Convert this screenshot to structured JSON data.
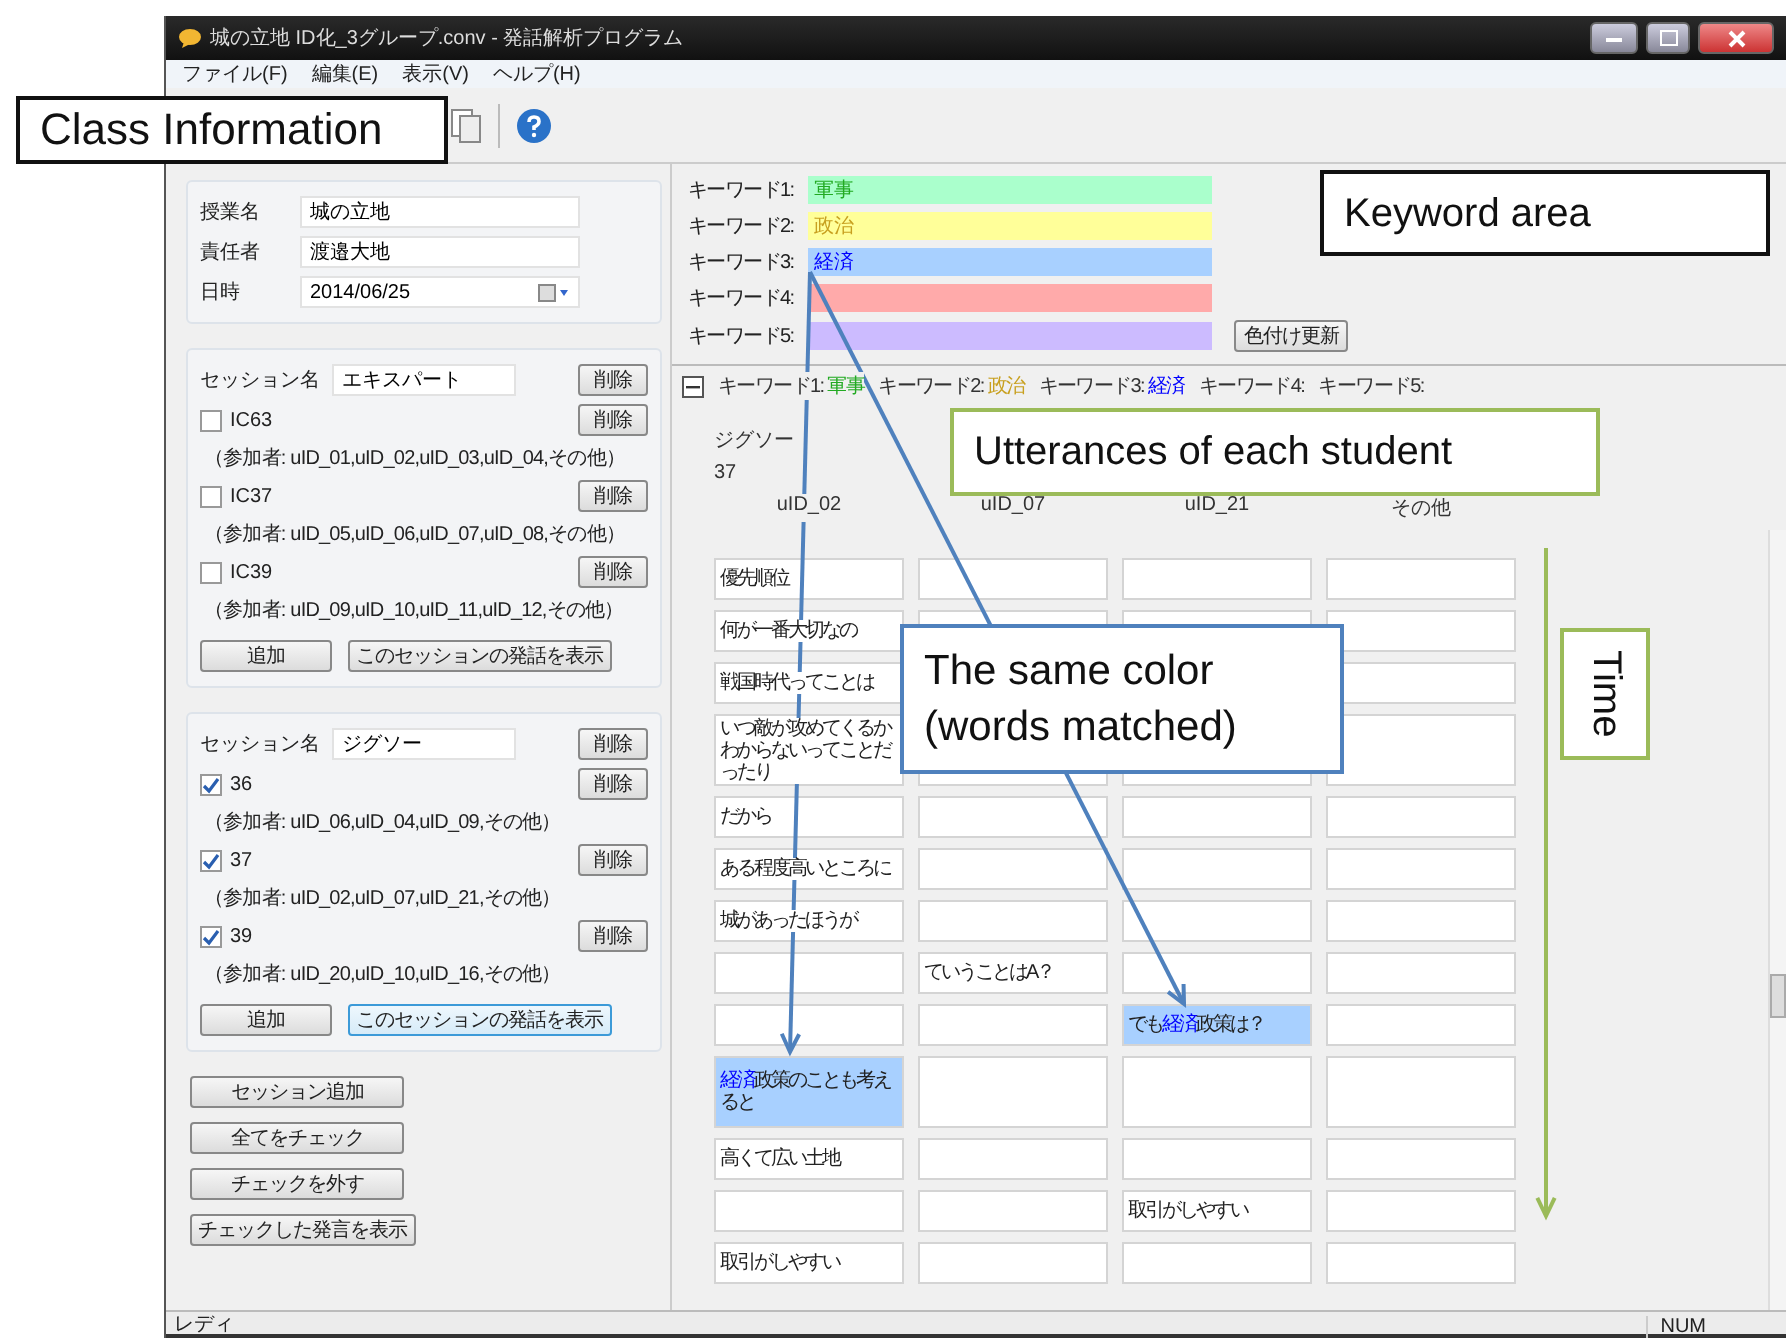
{
  "window": {
    "title": "城の立地 ID化_3グループ.conv - 発話解析プログラム"
  },
  "menu": [
    "ファイル(F)",
    "編集(E)",
    "表示(V)",
    "ヘルプ(H)"
  ],
  "class_info": {
    "fields": [
      {
        "label": "授業名",
        "value": "城の立地",
        "kind": "text"
      },
      {
        "label": "責任者",
        "value": "渡邉大地",
        "kind": "text"
      },
      {
        "label": "日時",
        "value": "2014/06/25",
        "kind": "date"
      }
    ]
  },
  "sessions": [
    {
      "name_label": "セッション名",
      "name": "エキスパート",
      "delete_label": "削除",
      "add_label": "追加",
      "show_label": "このセッションの発話を表示",
      "show_focused": false,
      "groups": [
        {
          "label": "IC63",
          "checked": false,
          "delete_label": "削除",
          "members": "（参加者: uID_01,uID_02,uID_03,uID_04,その他）"
        },
        {
          "label": "IC37",
          "checked": false,
          "delete_label": "削除",
          "members": "（参加者: uID_05,uID_06,uID_07,uID_08,その他）"
        },
        {
          "label": "IC39",
          "checked": false,
          "delete_label": "削除",
          "members": "（参加者: uID_09,uID_10,uID_11,uID_12,その他）"
        }
      ]
    },
    {
      "name_label": "セッション名",
      "name": "ジグソー",
      "delete_label": "削除",
      "add_label": "追加",
      "show_label": "このセッションの発話を表示",
      "show_focused": true,
      "groups": [
        {
          "label": "36",
          "checked": true,
          "delete_label": "削除",
          "members": "（参加者: uID_06,uID_04,uID_09,その他）"
        },
        {
          "label": "37",
          "checked": true,
          "delete_label": "削除",
          "members": "（参加者: uID_02,uID_07,uID_21,その他）"
        },
        {
          "label": "39",
          "checked": true,
          "delete_label": "削除",
          "members": "（参加者: uID_20,uID_10,uID_16,その他）"
        }
      ]
    }
  ],
  "actions": [
    "セッション追加",
    "全てをチェック",
    "チェックを外す",
    "チェックした発言を表示"
  ],
  "keywords": {
    "update_label": "色付け更新",
    "items": [
      {
        "label": "キーワード1:",
        "value": {
          "text": "軍事",
          "color": "#22aa22"
        },
        "field": {
          "color": "#aaffcc"
        }
      },
      {
        "label": "キーワード2:",
        "value": {
          "text": "政治",
          "color": "#c8a020"
        },
        "field": {
          "color": "#ffff99"
        }
      },
      {
        "label": "キーワード3:",
        "value": {
          "text": "経済",
          "color": "#0000ff"
        },
        "field": {
          "color": "#a8d0ff"
        }
      },
      {
        "label": "キーワード4:",
        "field": {
          "color": "#ffaaaa"
        }
      },
      {
        "label": "キーワード5:",
        "field": {
          "color": "#ccbbff"
        }
      }
    ]
  },
  "keyword_bar": {
    "expanded": true,
    "items": [
      {
        "label": "キーワード1:",
        "value": {
          "text": "軍事",
          "color": "#22aa22"
        }
      },
      {
        "label": "キーワード2:",
        "value": {
          "text": "政治",
          "color": "#c8a020"
        }
      },
      {
        "label": "キーワード3:",
        "value": {
          "text": "経済",
          "color": "#0000ff"
        }
      },
      {
        "label": "キーワード4:"
      },
      {
        "label": "キーワード5:"
      }
    ]
  },
  "utterances": {
    "group": "ジグソー",
    "session": "37",
    "columns": [
      "uID_02",
      "uID_07",
      "uID_21",
      "その他"
    ],
    "rows": [
      {
        "tall": false,
        "cells": [
          {
            "text": "優先順位",
            "highlighted": false
          },
          {
            "highlighted": false
          },
          {
            "highlighted": false
          },
          {
            "highlighted": false
          }
        ]
      },
      {
        "tall": false,
        "cells": [
          {
            "text": "何が一番大切なの",
            "highlighted": false
          },
          {
            "highlighted": false
          },
          {
            "highlighted": false
          },
          {
            "highlighted": false
          }
        ]
      },
      {
        "tall": false,
        "cells": [
          {
            "text": "戦国時代ってことは",
            "highlighted": false
          },
          null,
          null,
          {
            "highlighted": false
          }
        ]
      },
      {
        "tall": true,
        "cells": [
          {
            "text": "いつ敵が攻めてくるかわからないってことだったり",
            "highlighted": false
          },
          {
            "highlighted": false
          },
          {
            "highlighted": false
          },
          {
            "highlighted": false
          }
        ]
      },
      {
        "tall": false,
        "cells": [
          {
            "text": "だから",
            "highlighted": false
          },
          {
            "highlighted": false
          },
          {
            "highlighted": false
          },
          {
            "highlighted": false
          }
        ]
      },
      {
        "tall": false,
        "cells": [
          {
            "text": "ある程度高いところに",
            "highlighted": false
          },
          {
            "highlighted": false
          },
          {
            "highlighted": false
          },
          {
            "highlighted": false
          }
        ]
      },
      {
        "tall": false,
        "cells": [
          {
            "text": "城があったほうが",
            "highlighted": false
          },
          {
            "highlighted": false
          },
          {
            "highlighted": false
          },
          {
            "highlighted": false
          }
        ]
      },
      {
        "tall": false,
        "cells": [
          {
            "highlighted": false
          },
          {
            "text": "ていうことはA？",
            "highlighted": false
          },
          {
            "highlighted": false
          },
          {
            "highlighted": false
          }
        ]
      },
      {
        "tall": false,
        "cells": [
          {
            "highlighted": false
          },
          {
            "highlighted": false
          },
          {
            "parts": [
              {
                "text": "でも"
              },
              {
                "text": "経済",
                "color": "#0000ff"
              },
              {
                "text": "政策は？"
              }
            ],
            "highlighted": true
          },
          {
            "highlighted": false
          }
        ]
      },
      {
        "tall": true,
        "cells": [
          {
            "parts": [
              {
                "text": "経済",
                "color": "#0000ff"
              },
              {
                "text": "政策のことも考えると"
              }
            ],
            "highlighted": true
          },
          {
            "highlighted": false
          },
          {
            "highlighted": false
          },
          {
            "highlighted": false
          }
        ]
      },
      {
        "tall": false,
        "cells": [
          {
            "text": "高くて広い土地",
            "highlighted": false
          },
          {
            "highlighted": false
          },
          {
            "highlighted": false
          },
          {
            "highlighted": false
          }
        ]
      },
      {
        "tall": false,
        "cells": [
          {
            "highlighted": false
          },
          {
            "highlighted": false
          },
          {
            "text": "取引がしやすい",
            "highlighted": false
          },
          {
            "highlighted": false
          }
        ]
      },
      {
        "tall": false,
        "cells": [
          {
            "text": "取引がしやすい",
            "highlighted": false
          },
          {
            "highlighted": false
          },
          {
            "highlighted": false
          },
          {
            "highlighted": false
          }
        ]
      }
    ]
  },
  "status_bar": {
    "text": "レディ",
    "indicators": [
      "NUM"
    ]
  },
  "annotations": [
    {
      "kind": "black",
      "text": "Class Information"
    },
    {
      "kind": "black",
      "text": "Keyword area"
    },
    {
      "kind": "green",
      "text": "Utterances of each student"
    },
    {
      "kind": "blue",
      "text": "The same color (words matched)"
    },
    {
      "kind": "vertical",
      "text": "Time"
    }
  ]
}
